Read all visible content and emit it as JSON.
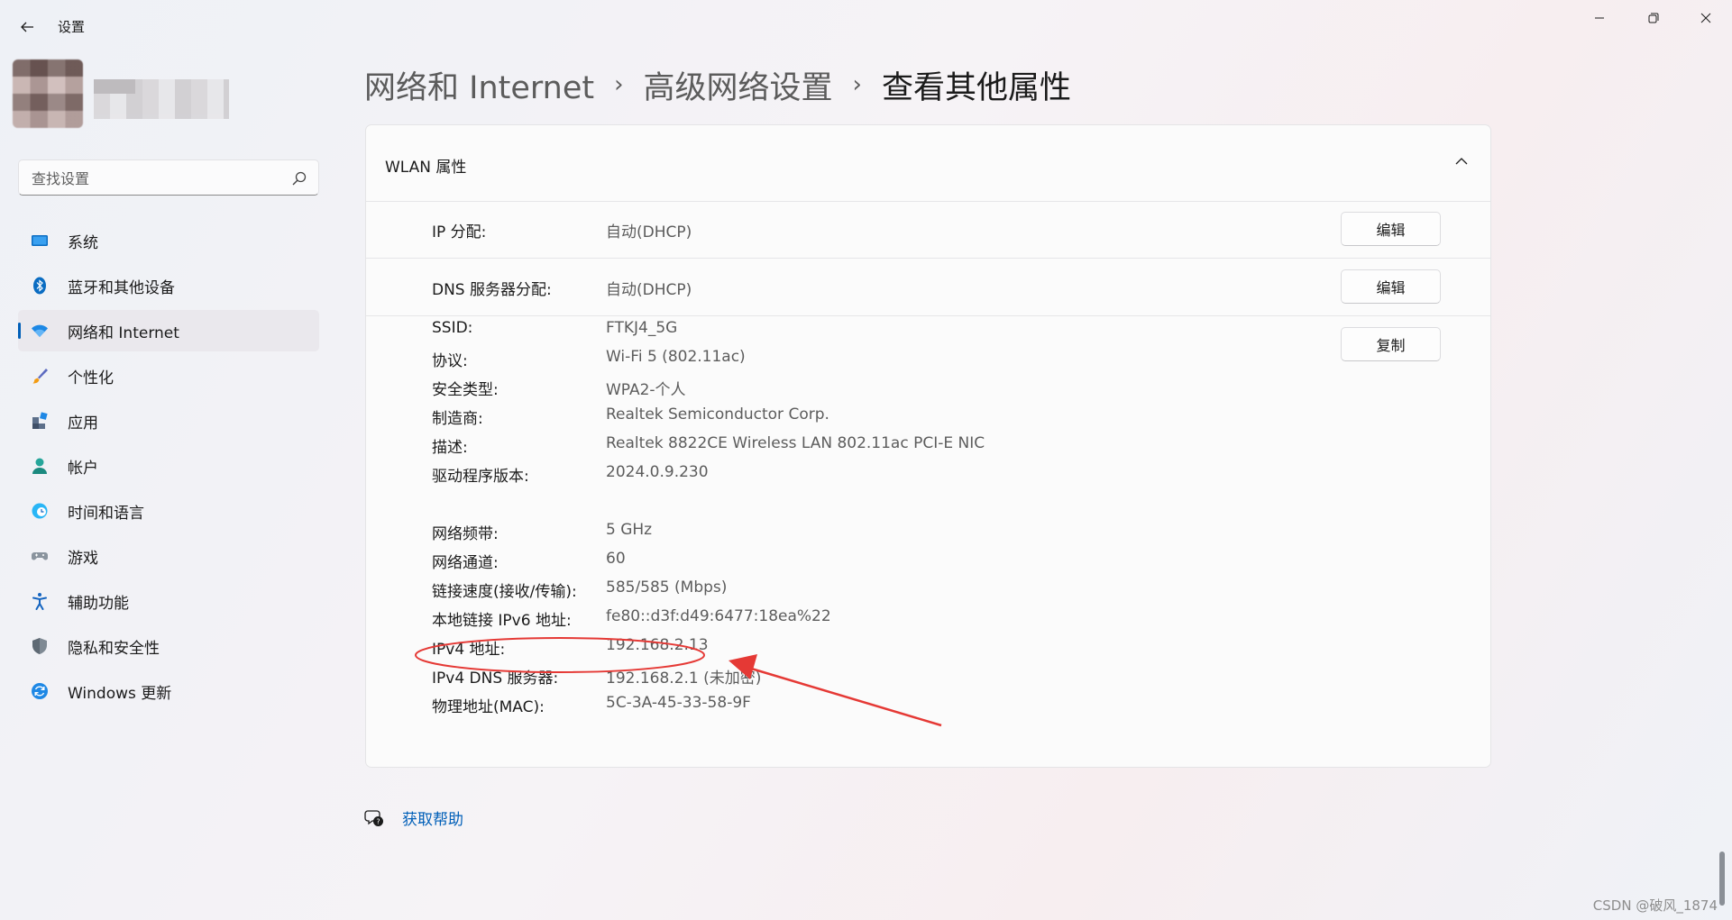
{
  "app": {
    "title": "设置"
  },
  "search": {
    "placeholder": "查找设置"
  },
  "nav": {
    "items": [
      {
        "label": "系统"
      },
      {
        "label": "蓝牙和其他设备"
      },
      {
        "label": "网络和 Internet",
        "active": true
      },
      {
        "label": "个性化"
      },
      {
        "label": "应用"
      },
      {
        "label": "帐户"
      },
      {
        "label": "时间和语言"
      },
      {
        "label": "游戏"
      },
      {
        "label": "辅助功能"
      },
      {
        "label": "隐私和安全性"
      },
      {
        "label": "Windows 更新"
      }
    ]
  },
  "breadcrumb": {
    "item1": "网络和 Internet",
    "item2": "高级网络设置",
    "current": "查看其他属性"
  },
  "card": {
    "title": "WLAN 属性",
    "edit_label": "编辑",
    "copy_label": "复制",
    "ip_assignment": {
      "label": "IP 分配:",
      "value": "自动(DHCP)"
    },
    "dns_assignment": {
      "label": "DNS 服务器分配:",
      "value": "自动(DHCP)"
    },
    "props": [
      {
        "label": "SSID:",
        "value": "FTKJ4_5G"
      },
      {
        "label": "协议:",
        "value": "Wi-Fi 5 (802.11ac)"
      },
      {
        "label": "安全类型:",
        "value": "WPA2-个人"
      },
      {
        "label": "制造商:",
        "value": "Realtek Semiconductor Corp."
      },
      {
        "label": "描述:",
        "value": "Realtek 8822CE Wireless LAN 802.11ac PCI-E NIC"
      },
      {
        "label": "驱动程序版本:",
        "value": "2024.0.9.230"
      },
      {
        "label": "网络频带:",
        "value": "5 GHz"
      },
      {
        "label": "网络通道:",
        "value": "60"
      },
      {
        "label": "链接速度(接收/传输):",
        "value": "585/585 (Mbps)"
      },
      {
        "label": "本地链接 IPv6 地址:",
        "value": "fe80::d3f:d49:6477:18ea%22"
      },
      {
        "label": "IPv4 地址:",
        "value": "192.168.2.13"
      },
      {
        "label": "IPv4 DNS 服务器:",
        "value": "192.168.2.1 (未加密)"
      },
      {
        "label": "物理地址(MAC):",
        "value": "5C-3A-45-33-58-9F"
      }
    ]
  },
  "help": {
    "label": "获取帮助"
  },
  "watermark": "CSDN @破风_1874",
  "colors": {
    "accent": "#005fb8",
    "annotation": "#e53935"
  }
}
